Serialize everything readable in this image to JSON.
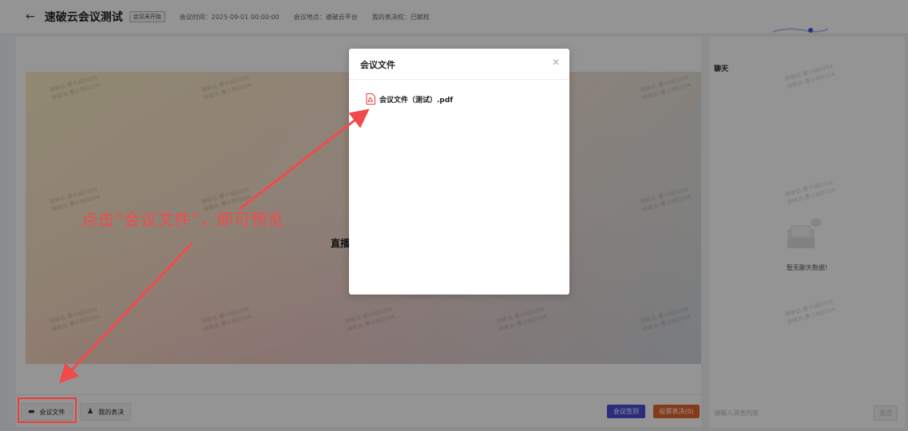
{
  "header": {
    "back_icon": "arrow-left-icon",
    "title": "速破云会议测试",
    "status_badge": "会议未开始",
    "meeting_time": "会议时间：2025-09-01 00:00:00",
    "meeting_place": "会议地点：速破云平台",
    "vote_right": "我的表决权：已赋权"
  },
  "stage": {
    "live_status": "直播未",
    "watermark_line1": "速破云-曹小绢0204",
    "watermark_line2": "速破云-曹小绢0204"
  },
  "toolbar": {
    "files_label": "会议文件",
    "files_icon": "folder-icon",
    "my_vote_label": "我的表决",
    "my_vote_icon": "user-vote-icon",
    "sign_in_label": "会议签到",
    "vote_label": "投票表决(0)"
  },
  "chat": {
    "title": "聊天",
    "empty_text": "暂无聊天数据!",
    "input_placeholder": "请输入消息内容",
    "send_label": "发送"
  },
  "modal": {
    "title": "会议文件",
    "close_icon": "close-icon",
    "files": [
      {
        "name": "会议文件（测试）.pdf",
        "icon": "pdf-file-icon"
      }
    ]
  },
  "annotation": {
    "text": "点击“会议文件”，即可预览",
    "color": "#f24a4a"
  },
  "colors": {
    "accent_blue": "#4b4fd6",
    "accent_orange": "#e5672d"
  }
}
